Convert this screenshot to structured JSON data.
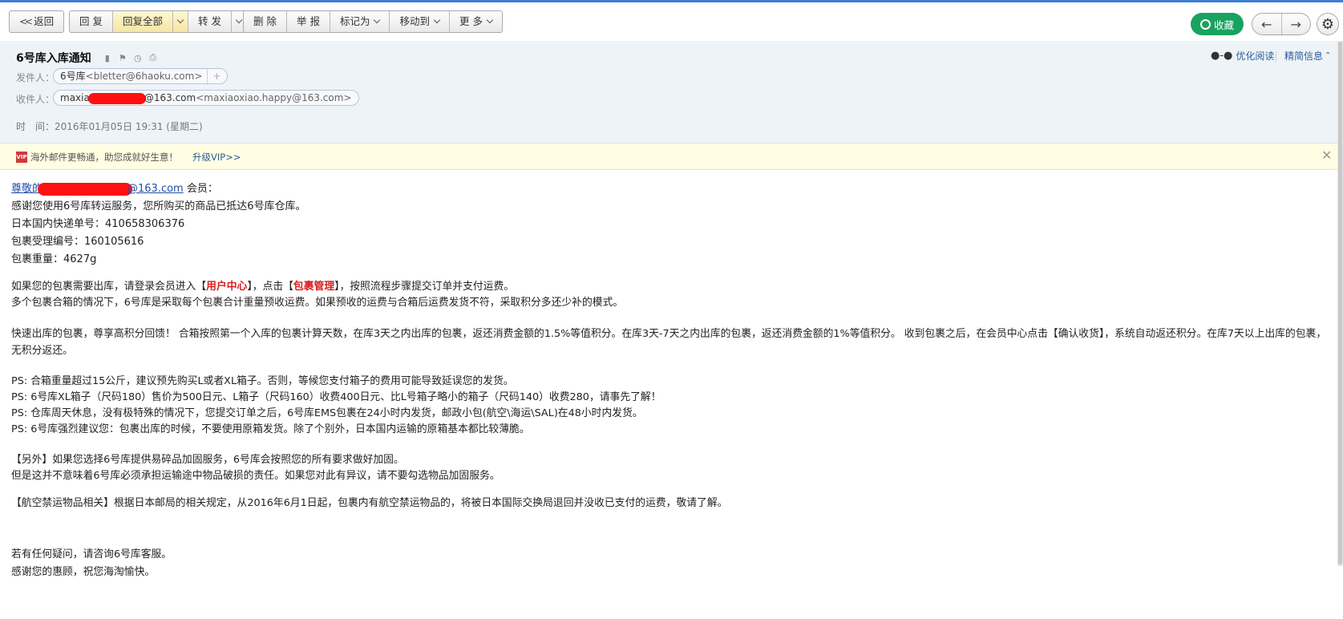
{
  "toolbar": {
    "back": "返回",
    "reply": "回 复",
    "reply_all": "回复全部",
    "forward": "转 发",
    "delete": "删 除",
    "report": "举 报",
    "mark_as": "标记为",
    "move_to": "移动到",
    "more": "更 多",
    "favorite": "收藏"
  },
  "header": {
    "subject": "6号库入库通知",
    "from_label": "发件人：",
    "from_name": "6号库",
    "from_email": "<bletter@6haoku.com>",
    "to_label": "收件人：",
    "to_name_start": "maxia",
    "to_name_end": "@163.com",
    "to_email": "<maxiaoxiao.happy@163.com>",
    "time": "时　间：2016年01月05日 19:31 (星期二)",
    "optimize_read": "优化阅读",
    "brief_info": "精简信息"
  },
  "vip": {
    "badge": "VIP",
    "text": "海外邮件更畅通，助您成就好生意！",
    "link": "升级VIP>>"
  },
  "body": {
    "greet_link_start": "尊敬的",
    "greet_link_end": "@163.com",
    "greet_suffix": " 会员：",
    "l1": "感谢您使用6号库转运服务，您所购买的商品已抵达6号库仓库。",
    "l2": "日本国内快递单号：410658306376",
    "l3": "包裹受理编号：160105616",
    "l4": "包裹重量：4627g",
    "p1a": "如果您的包裹需要出库，请登录会员进入【",
    "p1_user_center": "用户中心",
    "p1b": "】，点击【",
    "p1_package_mgmt": "包裹管理",
    "p1c": "】，按照流程步骤提交订单并支付运费。",
    "p2": "多个包裹合箱的情况下，6号库是采取每个包裹合计重量预收运费。如果预收的运费与合箱后运费发货不符，采取积分多还少补的模式。",
    "p3": "快速出库的包裹，尊享高积分回馈！ 合箱按照第一个入库的包裹计算天数，在库3天之内出库的包裹，返还消费金额的1.5%等值积分。在库3天-7天之内出库的包裹，返还消费金额的1%等值积分。 收到包裹之后，在会员中心点击【确认收货】，系统自动返还积分。在库7天以上出库的包裹，无积分返还。",
    "ps1": "PS: 合箱重量超过15公斤，建议预先购买L或者XL箱子。否则，等候您支付箱子的费用可能导致延误您的发货。",
    "ps2": "PS: 6号库XL箱子（尺码180）售价为500日元、L箱子（尺码160）收费400日元、比L号箱子略小的箱子（尺码140）收费280，请事先了解！",
    "ps3": "PS: 仓库周天休息，没有极特殊的情况下，您提交订单之后，6号库EMS包裹在24小时内发货，邮政小包(航空\\海运\\SAL)在48小时内发货。",
    "ps4": "PS: 6号库强烈建议您：包裹出库的时候，不要使用原箱发货。除了个别外，日本国内运输的原箱基本都比较薄脆。",
    "o1": "【另外】如果您选择6号库提供易碎品加固服务，6号库会按照您的所有要求做好加固。",
    "o2": "但是这并不意味着6号库必须承担运输途中物品破损的责任。如果您对此有异议，请不要勾选物品加固服务。",
    "air": "【航空禁运物品相关】根据日本邮局的相关规定，从2016年6月1日起，包裹内有航空禁运物品的，将被日本国际交换局退回并没收已支付的运费，敬请了解。",
    "end1": "若有任何疑问，请咨询6号库客服。",
    "end2": "感谢您的惠顾，祝您海淘愉快。"
  },
  "colors": {
    "accent_blue": "#3a7fd5",
    "favorite_green": "#1aa260",
    "header_bg": "#eef3f8",
    "vip_bg": "#fffde2",
    "highlight_red": "#d81e1e",
    "redaction_red": "#ff1010"
  }
}
